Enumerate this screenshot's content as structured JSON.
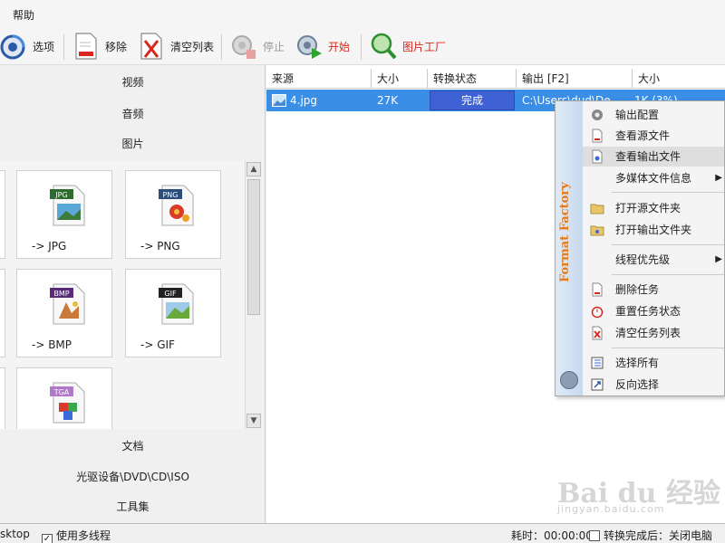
{
  "menubar": {
    "help": "帮助"
  },
  "toolbar": {
    "options": "选项",
    "remove": "移除",
    "clear_list": "清空列表",
    "stop": "停止",
    "start": "开始",
    "picture_factory": "图片工厂"
  },
  "left": {
    "categories_top": [
      "视频",
      "音频",
      "图片"
    ],
    "tiles": [
      {
        "label": "-> JPG",
        "badge": "JPG",
        "badge_color": "#2e6b2e"
      },
      {
        "label": "-> PNG",
        "badge": "PNG",
        "badge_color": "#2b4f7a"
      },
      {
        "label": "-> BMP",
        "badge": "BMP",
        "badge_color": "#5a2a7a"
      },
      {
        "label": "-> GIF",
        "badge": "GIF",
        "badge_color": "#222222"
      },
      {
        "label": "",
        "badge": "TGA",
        "badge_color": "#b07ac8"
      }
    ],
    "categories_bottom": [
      "文档",
      "光驱设备\\DVD\\CD\\ISO",
      "工具集"
    ]
  },
  "table": {
    "headers": [
      "来源",
      "大小",
      "转换状态",
      "输出 [F2]",
      "大小"
    ],
    "row": {
      "source": "4.jpg",
      "size": "27K",
      "status": "完成",
      "output": "C:\\Users\\dud\\De",
      "out_size": "1K  (3%)"
    }
  },
  "context_menu": {
    "brand": "Format Factory",
    "items": [
      "输出配置",
      "查看源文件",
      "查看输出文件",
      "多媒体文件信息",
      "打开源文件夹",
      "打开输出文件夹",
      "线程优先级",
      "删除任务",
      "重置任务状态",
      "清空任务列表",
      "选择所有",
      "反向选择"
    ]
  },
  "statusbar": {
    "left_text": "sktop",
    "multithread": "使用多线程",
    "elapsed": "耗时：00:00:00",
    "after_done": "转换完成后：关闭电脑"
  },
  "watermark": {
    "logo": "Bai du 经验",
    "url": "jingyan.baidu.com"
  },
  "colors": {
    "selection": "#3a8ee6",
    "status_bg": "#3e62d4",
    "accent_orange": "#e57a1a"
  }
}
